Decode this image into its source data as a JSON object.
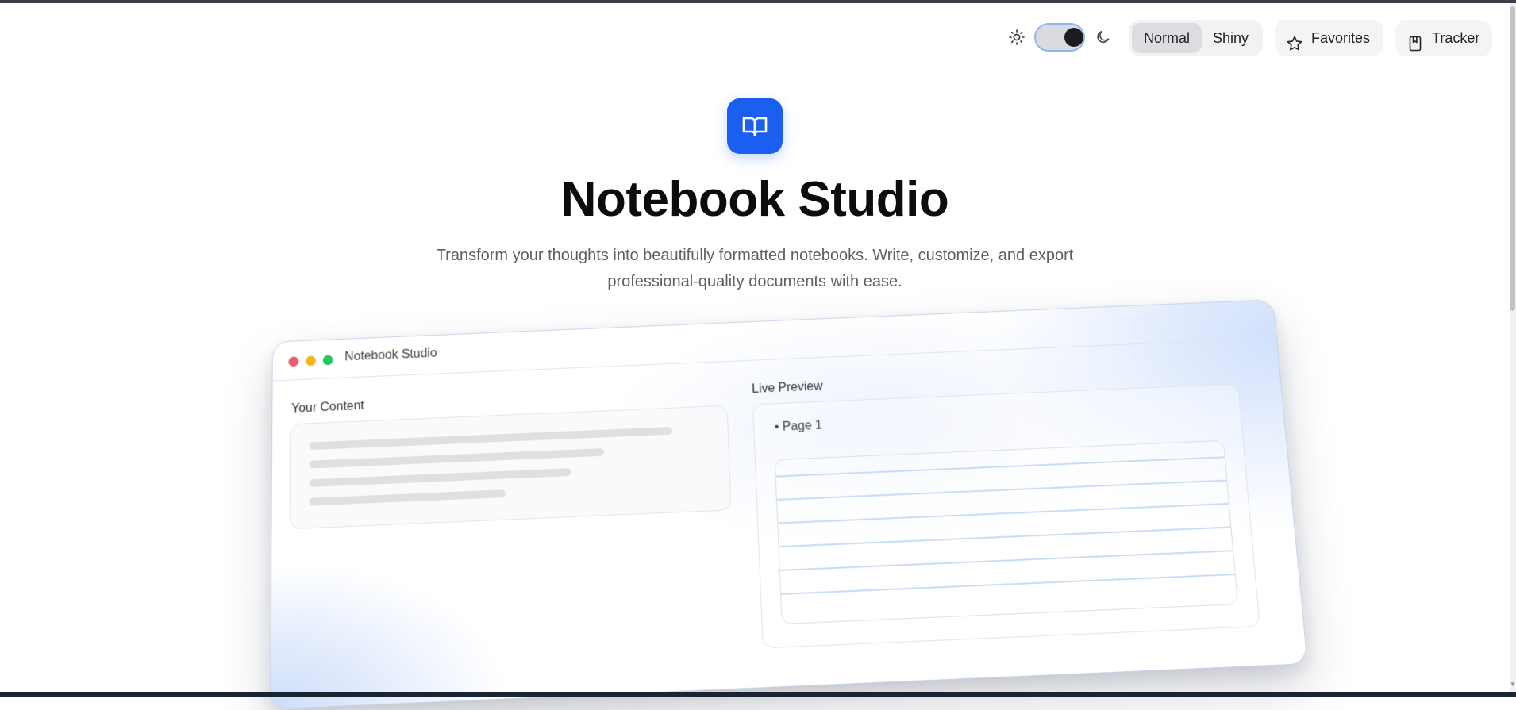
{
  "toolbar": {
    "theme_toggle": {
      "state": "dark",
      "light_icon": "sun-icon",
      "dark_icon": "moon-icon"
    },
    "style_switch": {
      "options": [
        "Normal",
        "Shiny"
      ],
      "selected": "Normal"
    },
    "favorites_label": "Favorites",
    "favorites_icon": "star-icon",
    "tracker_label": "Tracker",
    "tracker_icon": "bookmark-icon"
  },
  "hero": {
    "icon": "open-book-icon",
    "title": "Notebook Studio",
    "subtitle": "Transform your thoughts into beautifully formatted notebooks. Write, customize, and export professional-quality documents with ease."
  },
  "mockup": {
    "window_title": "Notebook Studio",
    "content_label": "Your Content",
    "preview_label": "Live Preview",
    "page_label": "• Page 1"
  },
  "colors": {
    "accent": "#1a5ff0",
    "dot_red": "#f05a6a",
    "dot_yellow": "#f4b41a",
    "dot_green": "#22c55e"
  }
}
